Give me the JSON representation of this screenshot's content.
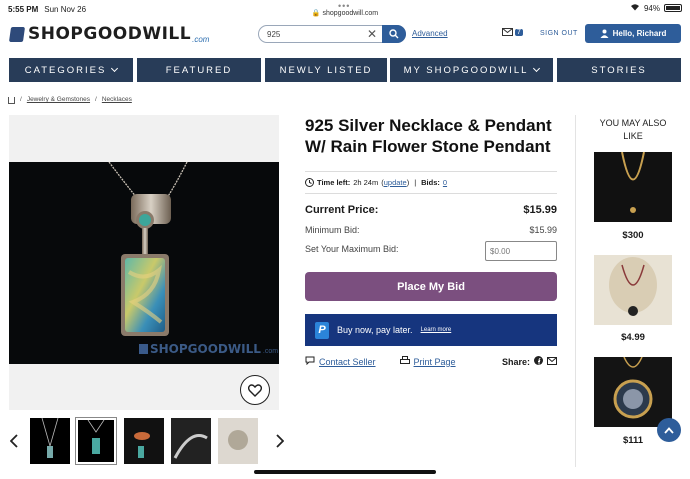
{
  "status": {
    "time": "5:55 PM",
    "date": "Sun Nov 26",
    "url": "shopgoodwill.com",
    "battery": "94%"
  },
  "header": {
    "logo_text": "SHOPGOODWILL",
    "logo_suffix": ".com",
    "search_value": "925",
    "advanced_label": "Advanced",
    "mail_count": "7",
    "signout_label": "SIGN OUT",
    "greeting": "Hello, Richard"
  },
  "nav": {
    "categories": "CATEGORIES",
    "featured": "FEATURED",
    "newly_listed": "NEWLY LISTED",
    "my_shopgoodwill": "MY SHOPGOODWILL",
    "stories": "STORIES"
  },
  "breadcrumb": {
    "level1": "Jewelry & Gemstones",
    "level2": "Necklaces"
  },
  "product": {
    "title": "925 Silver Necklace & Pendant W/ Rain Flower Stone Pendant",
    "time_left_label": "Time left:",
    "time_left_value": "2h 24m",
    "update_label": "update",
    "bids_label": "Bids:",
    "bids_value": "0",
    "current_price_label": "Current Price:",
    "current_price": "$15.99",
    "min_bid_label": "Minimum Bid:",
    "min_bid": "$15.99",
    "max_bid_label": "Set Your Maximum Bid:",
    "max_bid_placeholder": "$0.00",
    "bid_button": "Place My Bid",
    "paypal_text": "Buy now, pay later.",
    "paypal_learn": "Learn more",
    "contact_seller": "Contact Seller",
    "print_page": "Print Page",
    "share_label": "Share:",
    "watermark": "SHOPGOODWILL",
    "watermark_suffix": ".com"
  },
  "sidebar": {
    "heading": "YOU MAY ALSO LIKE",
    "items": [
      {
        "price": "$300"
      },
      {
        "price": "$4.99"
      },
      {
        "price": "$111"
      }
    ]
  },
  "thumbnails": {
    "count": 5
  },
  "colors": {
    "nav_bg": "#283c58",
    "accent_blue": "#2e5d9a",
    "bid_button": "#7b4f7f",
    "paypal_bg": "#16357e"
  }
}
